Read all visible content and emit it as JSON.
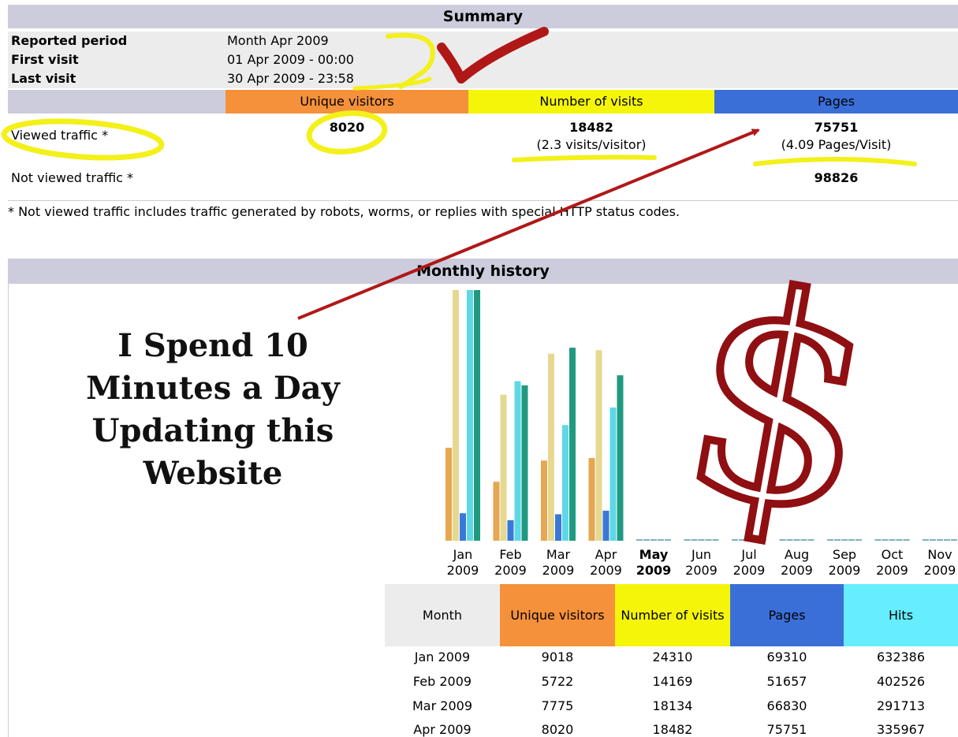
{
  "summary": {
    "title": "Summary",
    "rows": [
      {
        "label": "Reported period",
        "value": "Month Apr 2009"
      },
      {
        "label": "First visit",
        "value": "01 Apr 2009 - 00:00"
      },
      {
        "label": "Last visit",
        "value": "30 Apr 2009 - 23:58"
      }
    ],
    "columns": {
      "unique_visitors": "Unique visitors",
      "visits": "Number of visits",
      "pages": "Pages"
    },
    "viewed": {
      "label": "Viewed traffic *",
      "unique_visitors": "8020",
      "visits": "18482",
      "visits_sub": "(2.3 visits/visitor)",
      "pages": "75751",
      "pages_sub": "(4.09 Pages/Visit)"
    },
    "not_viewed": {
      "label": "Not viewed traffic *",
      "pages": "98826"
    },
    "footnote": "* Not viewed traffic includes traffic generated by robots, worms, or replies with special HTTP status codes."
  },
  "overlay": {
    "text_lines": [
      "I Spend 10",
      "Minutes a Day",
      "Updating this",
      "Website"
    ],
    "dollar": "$"
  },
  "monthly": {
    "title": "Monthly history",
    "table_headers": {
      "month": "Month",
      "unique": "Unique visitors",
      "visits": "Number of visits",
      "pages": "Pages",
      "hits": "Hits"
    },
    "rows": [
      {
        "month": "Jan 2009",
        "unique": "9018",
        "visits": "24310",
        "pages": "69310",
        "hits": "632386"
      },
      {
        "month": "Feb 2009",
        "unique": "5722",
        "visits": "14169",
        "pages": "51657",
        "hits": "402526"
      },
      {
        "month": "Mar 2009",
        "unique": "7775",
        "visits": "18134",
        "pages": "66830",
        "hits": "291713"
      },
      {
        "month": "Apr 2009",
        "unique": "8020",
        "visits": "18482",
        "pages": "75751",
        "hits": "335967"
      }
    ]
  },
  "colors": {
    "unique": "#f4913a",
    "visits": "#f5f50a",
    "pages": "#3a6fd8",
    "hits": "#66eeff",
    "header_bg": "#ccccdd",
    "annotation_yellow": "#f3f01a",
    "annotation_red": "#b01818"
  },
  "chart_data": {
    "type": "bar",
    "categories": [
      {
        "month": "Jan",
        "year": "2009",
        "current": false
      },
      {
        "month": "Feb",
        "year": "2009",
        "current": false
      },
      {
        "month": "Mar",
        "year": "2009",
        "current": false
      },
      {
        "month": "Apr",
        "year": "2009",
        "current": false
      },
      {
        "month": "May",
        "year": "2009",
        "current": true
      },
      {
        "month": "Jun",
        "year": "2009",
        "current": false
      },
      {
        "month": "Jul",
        "year": "2009",
        "current": false
      },
      {
        "month": "Aug",
        "year": "2009",
        "current": false
      },
      {
        "month": "Sep",
        "year": "2009",
        "current": false
      },
      {
        "month": "Oct",
        "year": "2009",
        "current": false
      },
      {
        "month": "Nov",
        "year": "2009",
        "current": false
      }
    ],
    "series": [
      {
        "key": "unique",
        "values": [
          9018,
          5722,
          7775,
          8020,
          0,
          0,
          0,
          0,
          0,
          0,
          0
        ],
        "color": "#e6a750"
      },
      {
        "key": "visits",
        "values": [
          24310,
          14169,
          18134,
          18482,
          0,
          0,
          0,
          0,
          0,
          0,
          0
        ],
        "color": "#e6d890"
      },
      {
        "key": "pages",
        "values": [
          69310,
          51657,
          66830,
          75751,
          0,
          0,
          0,
          0,
          0,
          0,
          0
        ],
        "color": "#3a78d8"
      },
      {
        "key": "hits",
        "values": [
          632386,
          402526,
          291713,
          335967,
          0,
          0,
          0,
          0,
          0,
          0,
          0
        ],
        "color": "#5ed8e6"
      },
      {
        "key": "bandwidth",
        "values": [
          100,
          62,
          77,
          66,
          0,
          0,
          0,
          0,
          0,
          0,
          0
        ],
        "unit": "relative",
        "color": "#1f9a80"
      }
    ]
  }
}
